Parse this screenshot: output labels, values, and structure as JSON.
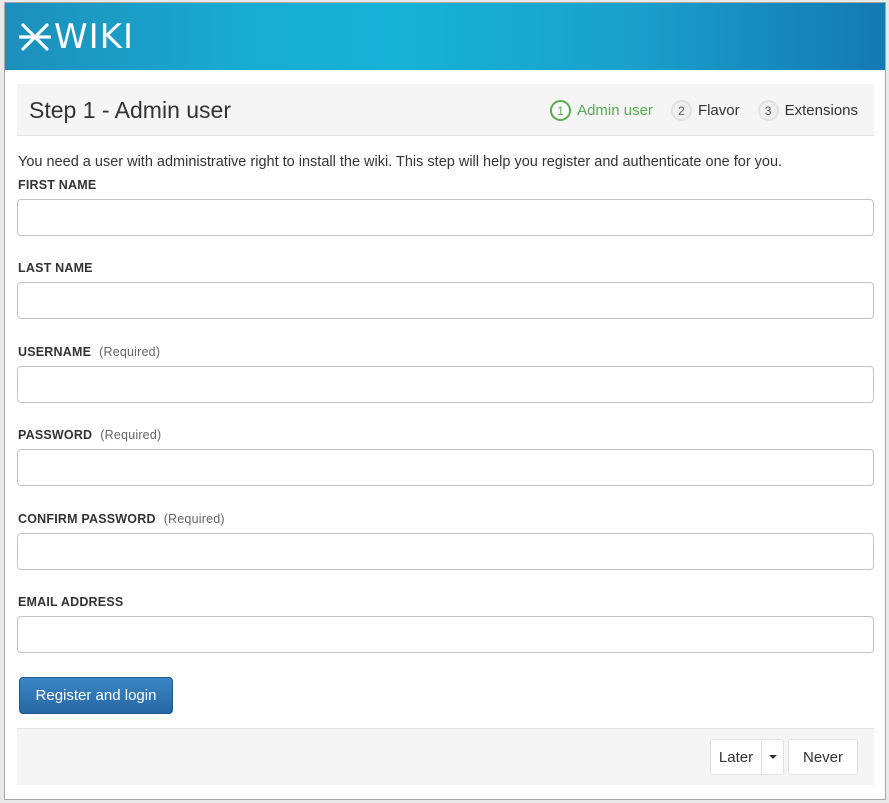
{
  "brand": {
    "logo_text": "WIKI",
    "header_gradient": [
      "#1d8fbc",
      "#16b2d6",
      "#1479b1"
    ]
  },
  "step_header": {
    "title": "Step 1 - Admin user",
    "steps": [
      {
        "number": "1",
        "label": "Admin user",
        "state": "active"
      },
      {
        "number": "2",
        "label": "Flavor",
        "state": "pending"
      },
      {
        "number": "3",
        "label": "Extensions",
        "state": "pending"
      }
    ]
  },
  "intro_text": "You need a user with administrative right to install the wiki. This step will help you register and authenticate one for you.",
  "form": {
    "fields": [
      {
        "label": "FIRST NAME",
        "required": "",
        "value": ""
      },
      {
        "label": "LAST NAME",
        "required": "",
        "value": ""
      },
      {
        "label": "USERNAME",
        "required": "(Required)",
        "value": ""
      },
      {
        "label": "PASSWORD",
        "required": "(Required)",
        "value": ""
      },
      {
        "label": "CONFIRM PASSWORD",
        "required": "(Required)",
        "value": ""
      },
      {
        "label": "EMAIL ADDRESS",
        "required": "",
        "value": ""
      }
    ],
    "submit_label": "Register and login"
  },
  "footer": {
    "later_label": "Later",
    "never_label": "Never"
  },
  "colors": {
    "accent_green": "#5aaa53",
    "primary_button": "#2e74b5"
  }
}
